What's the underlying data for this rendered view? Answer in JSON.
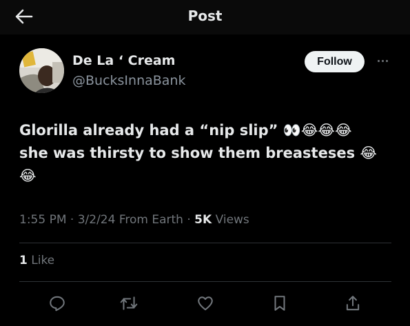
{
  "header": {
    "title": "Post",
    "back_icon": "arrow-left-icon"
  },
  "author": {
    "name": "De La ‘ Cream",
    "handle": "@BucksInnaBank",
    "follow_label": "Follow",
    "more_icon": "more-horizontal-icon"
  },
  "tweet": {
    "line1_text": "Glorilla already had a “nip slip” ",
    "line1_emoji": "👀😂😂😂",
    "line2_text": "she was thirsty to show them breasteses ",
    "line2_emoji": "😂",
    "line3_emoji": "😂"
  },
  "meta": {
    "time": "1:55 PM",
    "sep1": " · ",
    "date": "3/2/24",
    "source": " From Earth",
    "sep2": " · ",
    "views_count": "5K",
    "views_label": " Views"
  },
  "likes": {
    "count": "1",
    "label": " Like"
  },
  "actions": {
    "reply": "reply-icon",
    "retweet": "retweet-icon",
    "like": "heart-icon",
    "bookmark": "bookmark-icon",
    "share": "share-icon"
  },
  "colors": {
    "background": "#000000",
    "text": "#e7e9ea",
    "muted": "#71767b",
    "divider": "#2f3336",
    "follow_bg": "#eff3f4"
  }
}
